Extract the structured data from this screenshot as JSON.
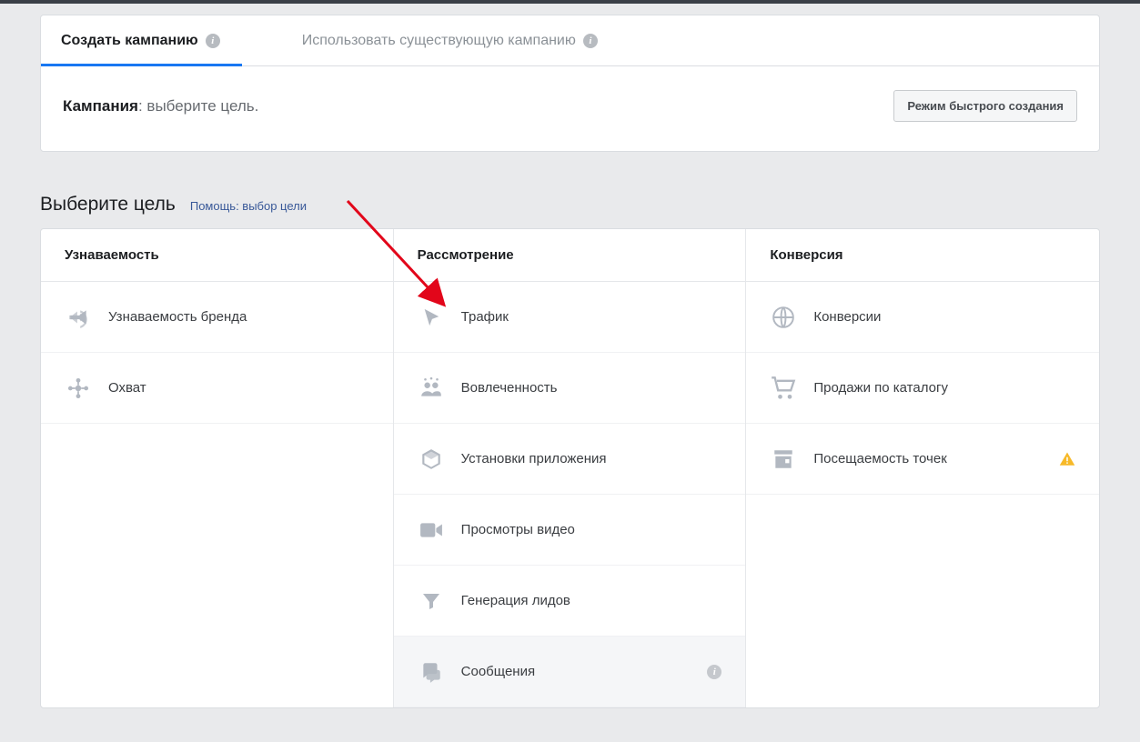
{
  "tabs": {
    "create": "Создать кампанию",
    "existing": "Использовать существующую кампанию"
  },
  "campaign": {
    "label": "Кампания",
    "subtext": ": выберите цель."
  },
  "buttons": {
    "quick_create": "Режим быстрого создания"
  },
  "section": {
    "title": "Выберите цель",
    "help": "Помощь: выбор цели"
  },
  "columns": {
    "awareness": "Узнаваемость",
    "consideration": "Рассмотрение",
    "conversion": "Конверсия"
  },
  "objectives": {
    "brand_awareness": "Узнаваемость бренда",
    "reach": "Охват",
    "traffic": "Трафик",
    "engagement": "Вовлеченность",
    "app_installs": "Установки приложения",
    "video_views": "Просмотры видео",
    "lead_gen": "Генерация лидов",
    "messages": "Сообщения",
    "conversions": "Конверсии",
    "catalog_sales": "Продажи по каталогу",
    "store_visits": "Посещаемость точек"
  }
}
